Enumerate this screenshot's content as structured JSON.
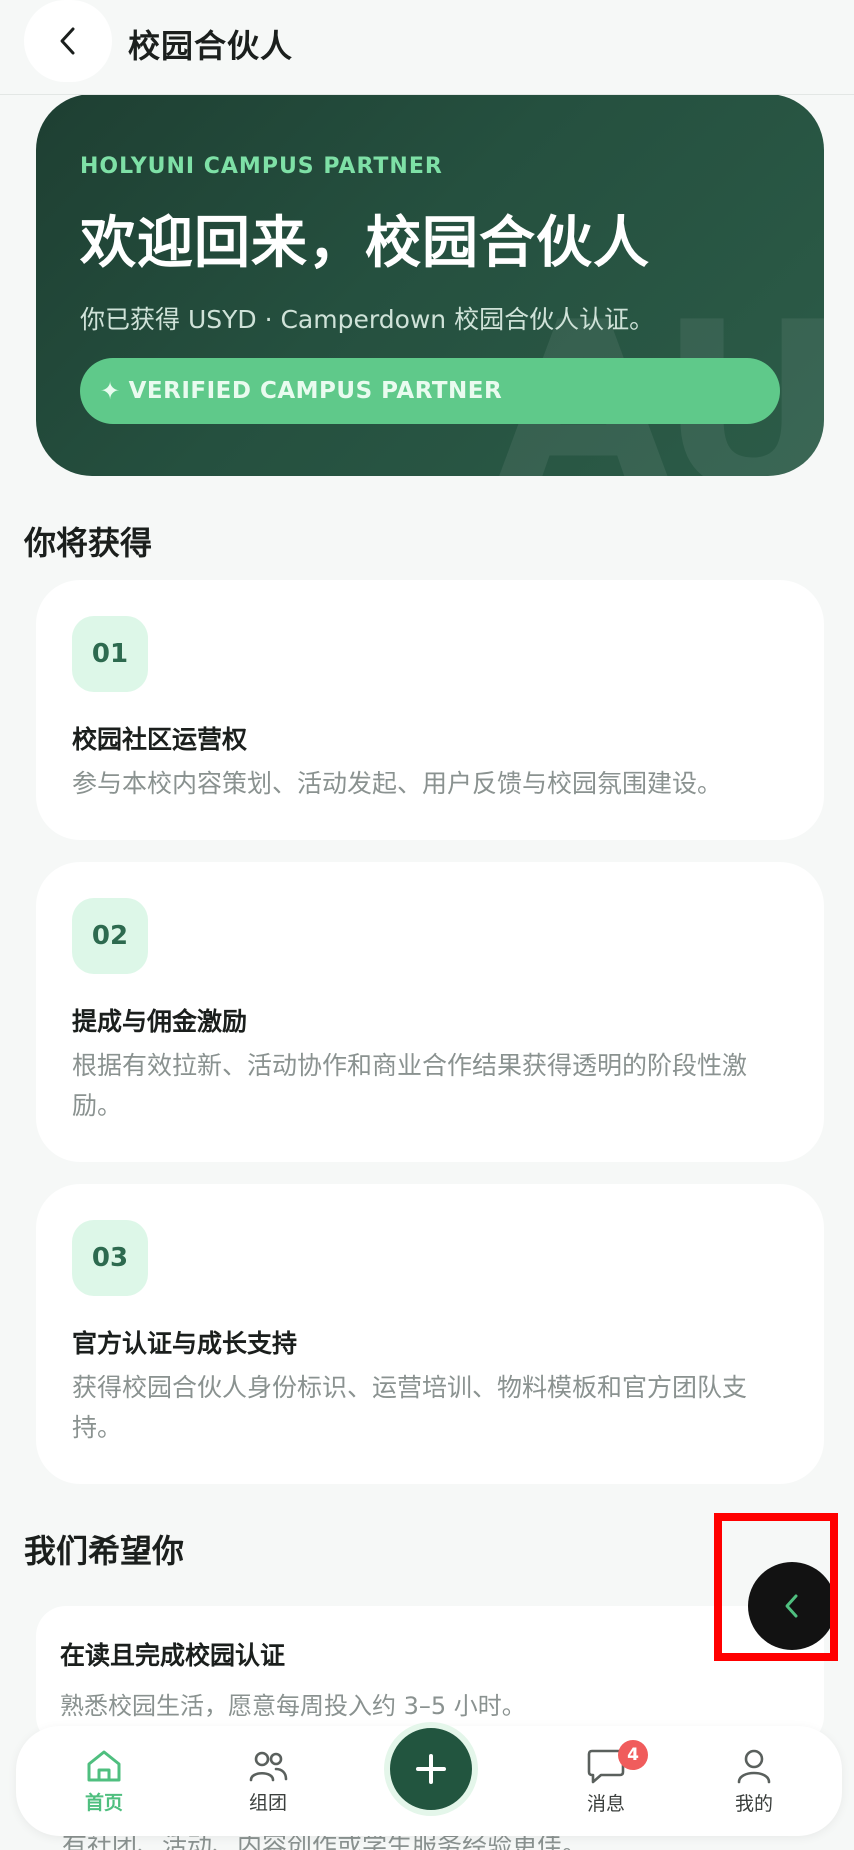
{
  "header": {
    "title": "校园合伙人"
  },
  "hero": {
    "kicker": "HOLYUNI CAMPUS PARTNER",
    "title": "欢迎回来，校园合伙人",
    "subtitle": "你已获得 USYD · Camperdown 校园合伙人认证。",
    "watermark": "AU",
    "badge_icon": "✦",
    "badge_label": "VERIFIED CAMPUS PARTNER"
  },
  "benefits": {
    "section_title": "你将获得",
    "items": [
      {
        "num": "01",
        "title": "校园社区运营权",
        "desc": "参与本校内容策划、活动发起、用户反馈与校园氛围建设。"
      },
      {
        "num": "02",
        "title": "提成与佣金激励",
        "desc": "根据有效拉新、活动协作和商业合作结果获得透明的阶段性激励。"
      },
      {
        "num": "03",
        "title": "官方认证与成长支持",
        "desc": "获得校园合伙人身份标识、运营培训、物料模板和官方团队支持。"
      }
    ]
  },
  "requirements": {
    "section_title": "我们希望你",
    "items": [
      {
        "title": "在读且完成校园认证",
        "desc": "熟悉校园生活，愿意每周投入约 3–5 小时。"
      }
    ],
    "peek_text": "有社团、活动、内容创作或学生服务经验更佳。"
  },
  "bottom_nav": {
    "items": [
      {
        "label": "首页",
        "icon": "home-icon",
        "active": true
      },
      {
        "label": "组团",
        "icon": "group-icon",
        "active": false
      },
      {
        "label": "",
        "icon": "plus-icon",
        "active": false
      },
      {
        "label": "消息",
        "icon": "message-icon",
        "active": false,
        "badge": "4"
      },
      {
        "label": "我的",
        "icon": "user-icon",
        "active": false
      }
    ]
  },
  "floating": {
    "icon": "chevron-left-icon"
  },
  "colors": {
    "brand_dark": "#22553f",
    "accent_green": "#5fc98a",
    "active_nav": "#4fbf7f",
    "badge_red": "#f05c5c",
    "highlight": "#ff0000"
  }
}
